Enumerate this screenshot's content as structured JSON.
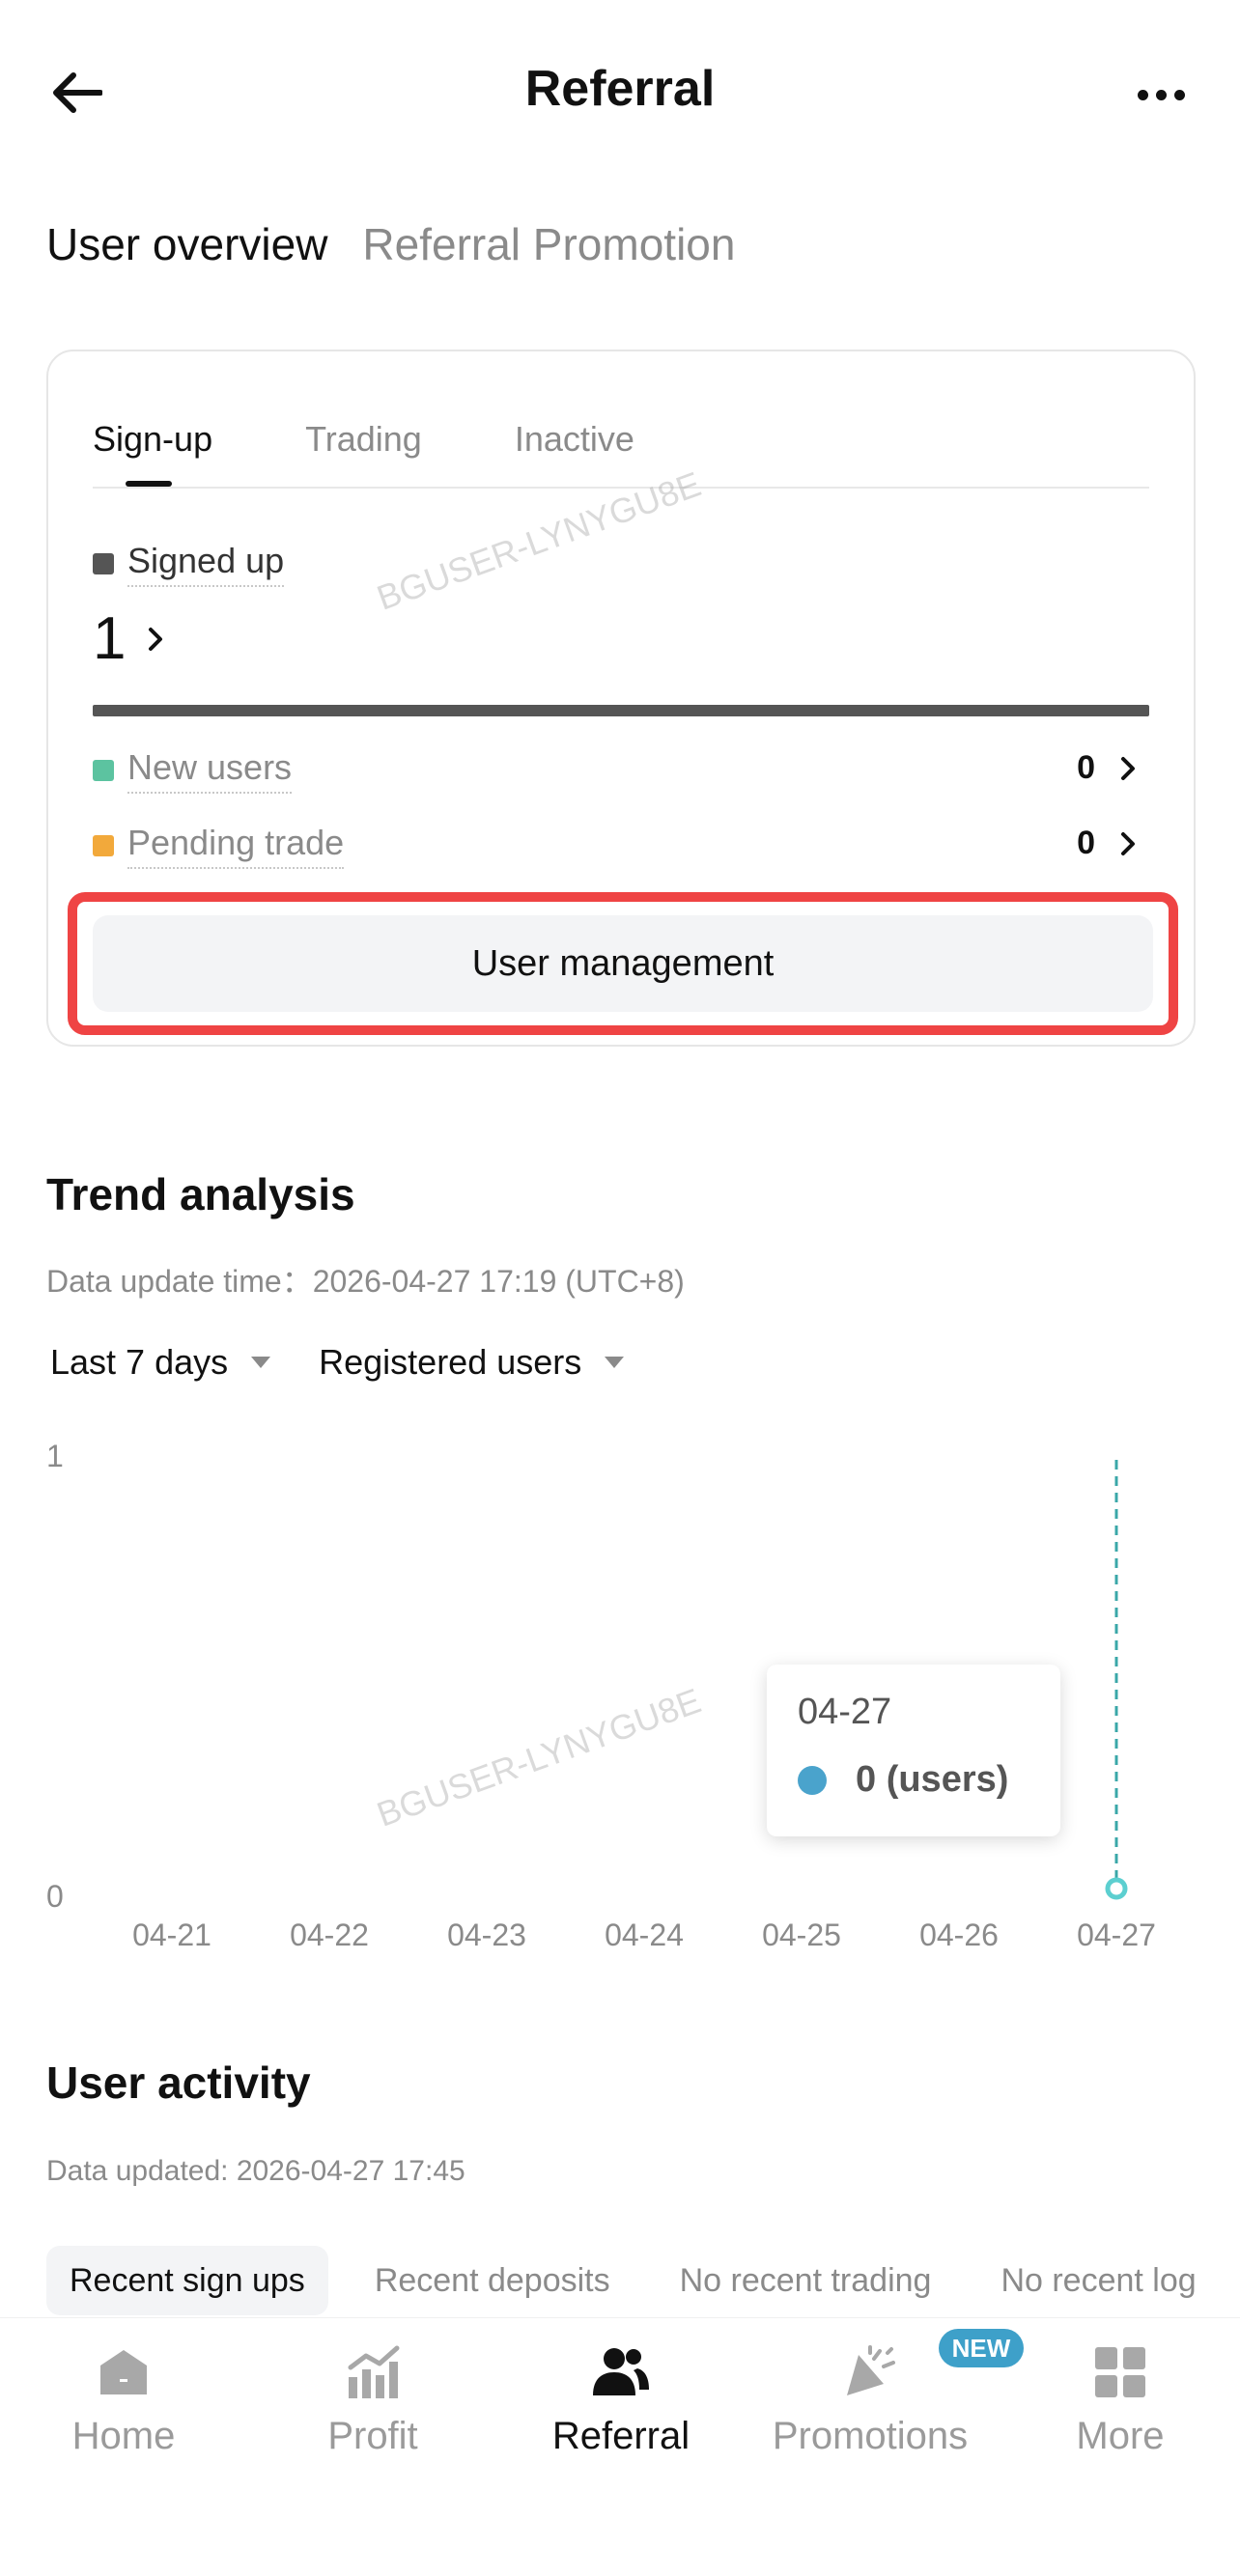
{
  "header": {
    "title": "Referral",
    "back_icon": "arrow-left-icon",
    "more_icon": "more-dots-icon"
  },
  "top_tabs": [
    {
      "label": "User overview",
      "active": true
    },
    {
      "label": "Referral Promotion",
      "active": false
    }
  ],
  "overview": {
    "sub_tabs": [
      {
        "label": "Sign-up",
        "active": true
      },
      {
        "label": "Trading",
        "active": false
      },
      {
        "label": "Inactive",
        "active": false
      }
    ],
    "signed_up": {
      "label": "Signed up",
      "count": "1",
      "color": "#555555"
    },
    "new_users": {
      "label": "New users",
      "count": "0",
      "color": "#5cc3a0"
    },
    "pending_trade": {
      "label": "Pending trade",
      "count": "0",
      "color": "#f2a93b"
    },
    "user_management_label": "User management",
    "highlight_color": "#ef4444"
  },
  "watermark": "BGUSER-LYNYGU8E",
  "trend": {
    "title": "Trend analysis",
    "update_time": "Data update time：2026-04-27 17:19 (UTC+8)",
    "filters": [
      {
        "label": "Last 7 days"
      },
      {
        "label": "Registered users"
      }
    ],
    "tooltip": {
      "date": "04-27",
      "value": "0 (users)"
    }
  },
  "chart_data": {
    "type": "line",
    "x": [
      "04-21",
      "04-22",
      "04-23",
      "04-24",
      "04-25",
      "04-26",
      "04-27"
    ],
    "series": [
      {
        "name": "",
        "values": [
          0,
          0,
          0,
          0,
          0,
          0,
          0
        ]
      }
    ],
    "yticks": [
      "1",
      "0"
    ],
    "ylim": [
      0,
      1
    ],
    "selected_index": 6,
    "marker_color": "#5ccfd0",
    "tooltip_color": "#4aa3cc"
  },
  "activity": {
    "title": "User activity",
    "update_time": "Data updated: 2026-04-27 17:45",
    "tabs": [
      {
        "label": "Recent sign ups",
        "active": true
      },
      {
        "label": "Recent deposits",
        "active": false
      },
      {
        "label": "No recent trading",
        "active": false
      },
      {
        "label": "No recent login",
        "active": false
      }
    ]
  },
  "bottom_nav": {
    "items": [
      {
        "label": "Home",
        "icon": "home-icon",
        "active": false
      },
      {
        "label": "Profit",
        "icon": "profit-chart-icon",
        "active": false
      },
      {
        "label": "Referral",
        "icon": "referral-users-icon",
        "active": true
      },
      {
        "label": "Promotions",
        "icon": "megaphone-icon",
        "active": false
      },
      {
        "label": "More",
        "icon": "grid-icon",
        "active": false
      }
    ],
    "new_badge": "NEW"
  }
}
